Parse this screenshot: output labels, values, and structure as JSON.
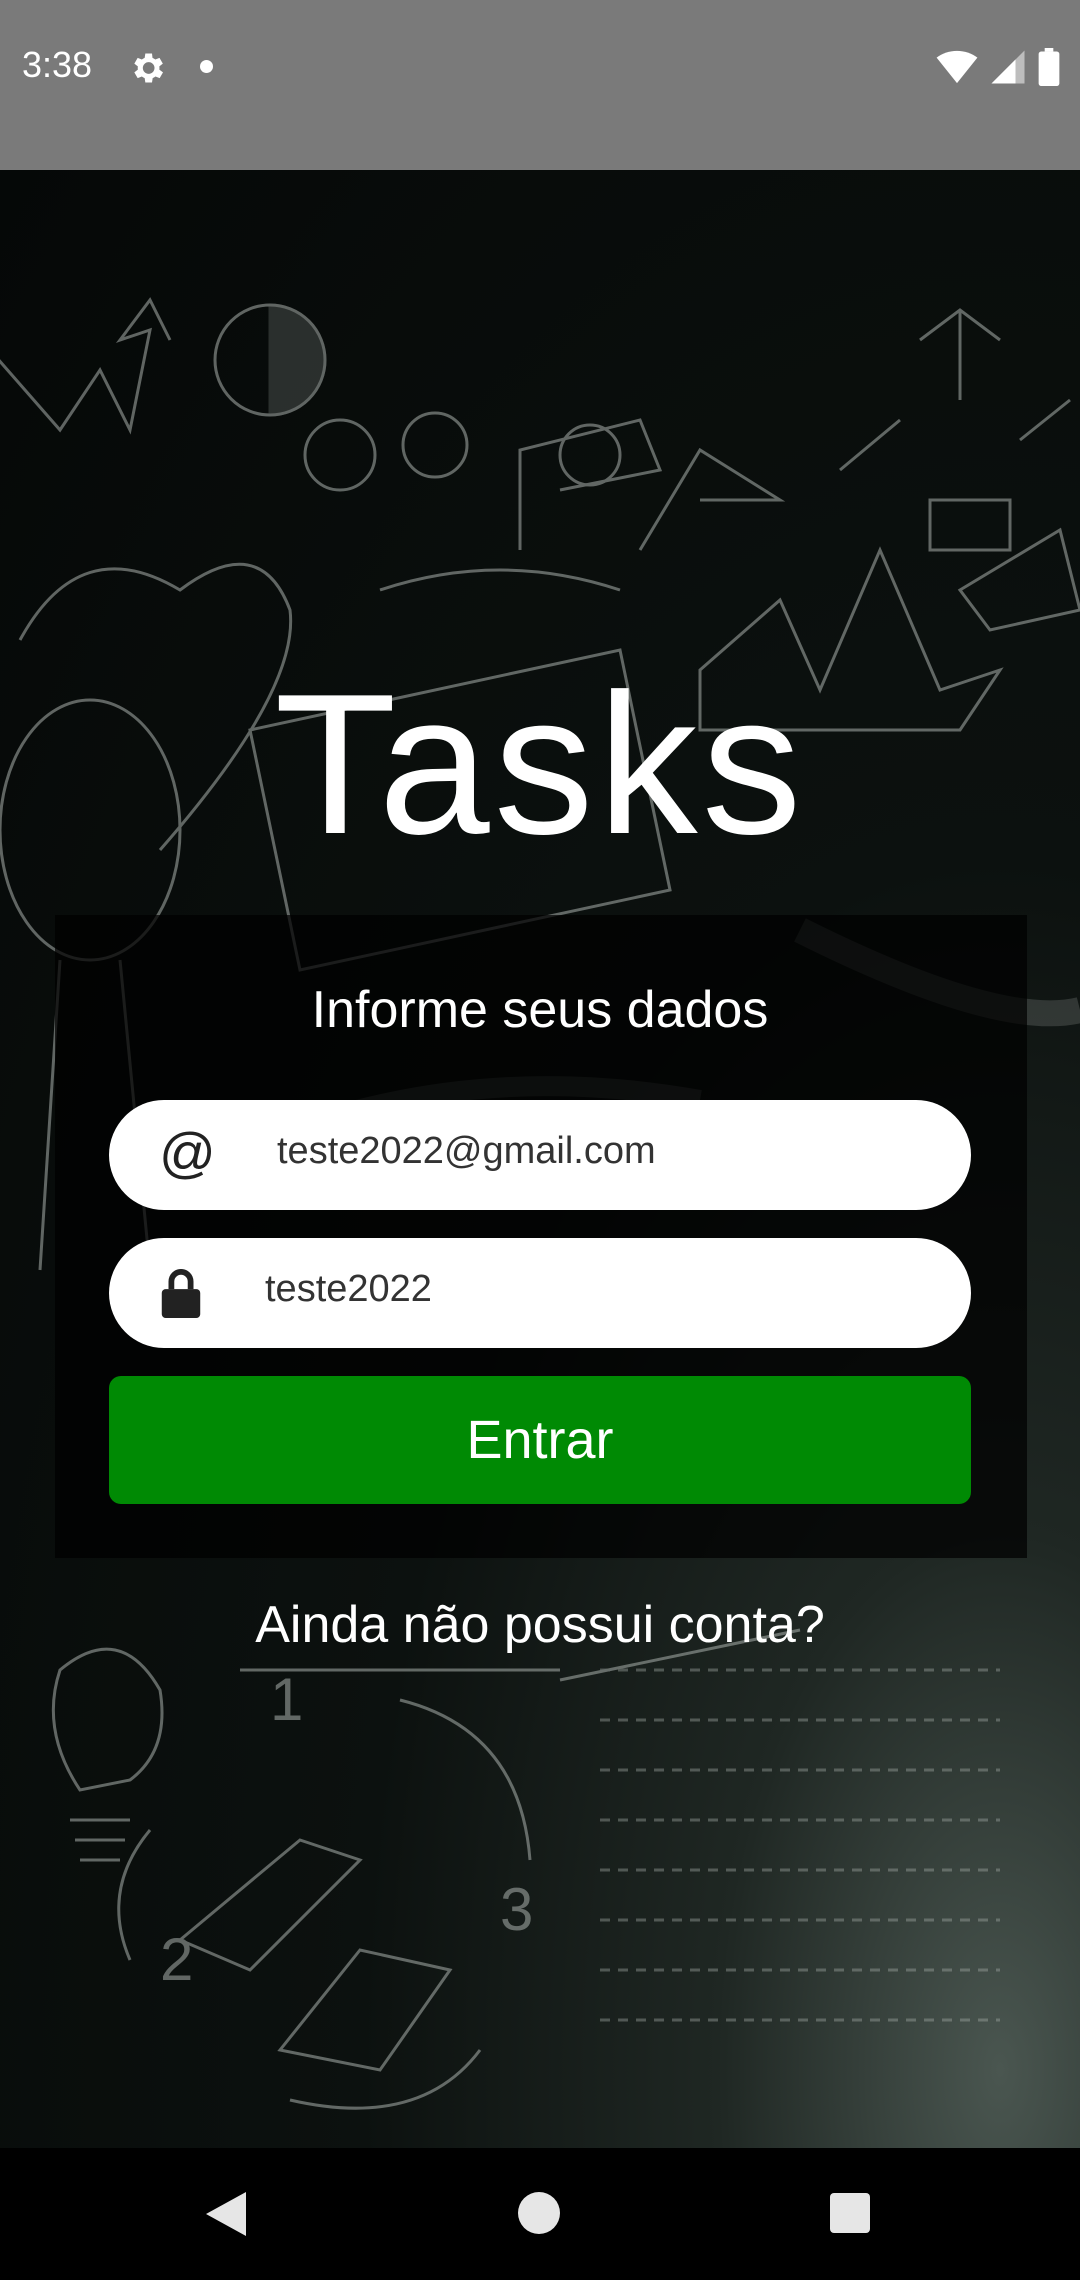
{
  "status_bar": {
    "time": "3:38"
  },
  "title": "Tasks",
  "form": {
    "subtitle": "Informe seus dados",
    "email_value": "teste2022@gmail.com",
    "email_icon": "@",
    "password_value": "teste2022",
    "submit_label": "Entrar"
  },
  "signup_link": "Ainda não possui conta?",
  "colors": {
    "primary_button": "#008a04",
    "status_bar": "#7a7a7a",
    "card_background": "rgba(0,0,0,0.72)"
  }
}
